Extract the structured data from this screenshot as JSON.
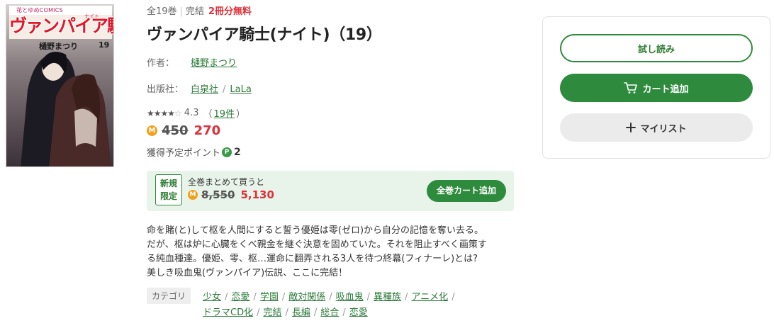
{
  "cover": {
    "publisher_label": "花とゆめCOMICS",
    "title_art": "ヴァンパイア騎士",
    "ruby_art": "ナイト",
    "author_art": "樋野まつり",
    "volume_art": "19"
  },
  "meta": {
    "total_volumes": "全19巻",
    "status": "完結",
    "free_badge": "2冊分無料"
  },
  "title": "ヴァンパイア騎士(ナイト)（19）",
  "author": {
    "label": "作者：",
    "name": "樋野まつり"
  },
  "publisher": {
    "label": "出版社：",
    "name": "白泉社",
    "label_name": "LaLa"
  },
  "rating": {
    "value_text": "4.3",
    "stars": 4.3,
    "reviews_text": "19件",
    "open": "（",
    "close": "）"
  },
  "price": {
    "coin": "M",
    "original": "450",
    "sale": "270"
  },
  "points": {
    "label": "獲得予定ポイント",
    "coin": "P",
    "value": "2"
  },
  "bundle": {
    "badge_line1": "新規",
    "badge_line2": "限定",
    "text": "全巻まとめて買うと",
    "coin": "M",
    "original": "8,550",
    "sale": "5,130",
    "button": "全巻カート追加"
  },
  "description": [
    "命を賭(と)して枢を人間にすると誓う優姫は零(ゼロ)から自分の記憶を奪い去る。",
    "だが、枢は炉に心臓をくべ親金を継ぐ決意を固めていた。それを阻止すべく画策す",
    "る純血種達。優姫、零、枢…運命に翻弄される3人を待つ終幕(フィナーレ)とは?",
    "美しき吸血鬼(ヴァンパイア)伝説、ここに完結！"
  ],
  "categories": {
    "label": "カテゴリ",
    "items": [
      "少女",
      "恋愛",
      "学園",
      "敵対関係",
      "吸血鬼",
      "異種族",
      "アニメ化",
      "ドラマCD化",
      "完結",
      "長編",
      "総合",
      "恋愛"
    ]
  },
  "actions": {
    "trial": "試し読み",
    "cart": "カート追加",
    "mylist": "マイリスト"
  },
  "colors": {
    "accent_green": "#2e8b3e",
    "price_red": "#e0303a",
    "link_green": "#2b7a3a",
    "coin_orange": "#f0a01c",
    "bundle_bg": "#e8f4ea"
  }
}
